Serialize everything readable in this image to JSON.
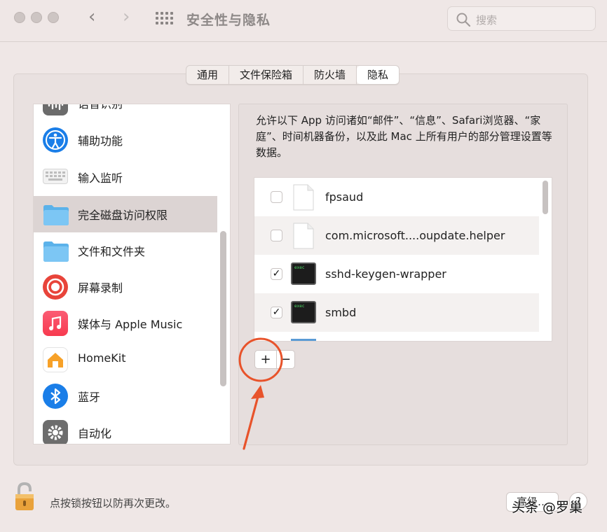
{
  "window": {
    "title": "安全性与隐私",
    "back_icon": "chevron-left-icon",
    "forward_icon": "chevron-right-icon"
  },
  "search": {
    "placeholder": "搜索"
  },
  "tabs": [
    {
      "label": "通用"
    },
    {
      "label": "文件保险箱"
    },
    {
      "label": "防火墙"
    },
    {
      "label": "隐私",
      "selected": true
    }
  ],
  "sidebar": {
    "items": [
      {
        "label": "语音识别",
        "icon": "speech-recognition-icon"
      },
      {
        "label": "辅助功能",
        "icon": "accessibility-icon"
      },
      {
        "label": "输入监听",
        "icon": "keyboard-icon"
      },
      {
        "label": "完全磁盘访问权限",
        "icon": "folder-icon",
        "selected": true
      },
      {
        "label": "文件和文件夹",
        "icon": "folder-icon"
      },
      {
        "label": "屏幕录制",
        "icon": "screen-record-icon"
      },
      {
        "label": "媒体与 Apple Music",
        "icon": "music-icon"
      },
      {
        "label": "HomeKit",
        "icon": "home-icon"
      },
      {
        "label": "蓝牙",
        "icon": "bluetooth-icon"
      },
      {
        "label": "自动化",
        "icon": "gear-icon"
      }
    ]
  },
  "main": {
    "description": "允许以下 App 访问诸如“邮件”、“信息”、Safari浏览器、“家庭”、时间机器备份，以及此 Mac 上所有用户的部分管理设置等数据。",
    "apps": [
      {
        "name": "fpsaud",
        "checked": false,
        "icon": "document-icon"
      },
      {
        "name": "com.microsoft....oupdate.helper",
        "checked": false,
        "icon": "document-icon"
      },
      {
        "name": "sshd-keygen-wrapper",
        "checked": true,
        "icon": "exec-terminal-icon"
      },
      {
        "name": "smbd",
        "checked": true,
        "icon": "exec-terminal-icon"
      }
    ],
    "exec_badge": "exec",
    "add_label": "+",
    "remove_label": "−"
  },
  "footer": {
    "lock_text": "点按锁按钮以防再次更改。",
    "advanced_label": "高级…",
    "help_label": "?",
    "watermark": "头条 @罗巢"
  },
  "colors": {
    "annotation": "#e8532b",
    "selected_row": "#dcd4d3"
  }
}
